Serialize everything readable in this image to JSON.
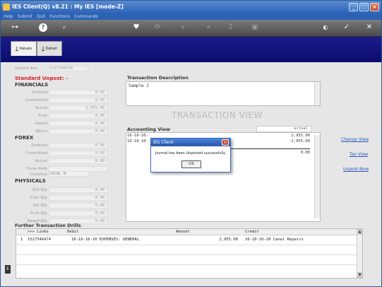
{
  "window": {
    "title": "IES Client(Q) v8.21 : My IES          [mode-Z]"
  },
  "menu": [
    "Help",
    "Submit",
    "Quit",
    "Functions",
    "Commands"
  ],
  "toolbar": {
    "help": "?",
    "search": "🔍"
  },
  "tabs": [
    {
      "num": "1",
      "label": "Values"
    },
    {
      "num": "2",
      "label": "Detail"
    }
  ],
  "system_key": {
    "label": "System Key",
    "value": "1527546474"
  },
  "standard_unpost": "Standard Unpost: -",
  "financials": {
    "title": "FINANCIALS",
    "rows": [
      {
        "label": "Ordered",
        "value": "0.00"
      },
      {
        "label": "Committed",
        "value": "0.00"
      },
      {
        "label": "Actual",
        "value": "2,955.00"
      },
      {
        "label": "Trust",
        "value": "0.00"
      },
      {
        "label": "Award",
        "value": "0.00"
      },
      {
        "label": "Memo",
        "value": "0.00"
      }
    ]
  },
  "forex": {
    "title": "FOREX",
    "rows": [
      {
        "label": "Ordered",
        "value": "0.00"
      },
      {
        "label": "Committed",
        "value": "0.00"
      },
      {
        "label": "Actual",
        "value": "0.00"
      },
      {
        "label": "Forex Rate",
        "value": ""
      },
      {
        "label": "Currency",
        "value": "LOCAL N"
      }
    ]
  },
  "physicals": {
    "title": "PHYSICALS",
    "rows": [
      {
        "label": "Ord Qty",
        "value": "0.00"
      },
      {
        "label": "Com Qty",
        "value": "0.00"
      },
      {
        "label": "Act Qty",
        "value": "0.00"
      },
      {
        "label": "Trust Qty",
        "value": "0.00"
      },
      {
        "label": "Award Qty",
        "value": "0.00"
      }
    ]
  },
  "transaction": {
    "desc_label": "Transaction Description",
    "desc_value": "Sample J",
    "view_title": "TRANSACTION VIEW",
    "accounting_view": "Accounting View",
    "actual_col": "actual",
    "rows": [
      {
        "acct": "10-10-10-",
        "amount": "2,955.00"
      },
      {
        "acct": "10-10-10-",
        "amount": "-2,955.00"
      }
    ],
    "total": "0.00"
  },
  "links": {
    "change_view": "Change View",
    "tax_view": "Tax View",
    "unpost_now": "Unpost Now"
  },
  "dialog": {
    "title": "IES Client",
    "message": "Journal has been Unposted successfully.",
    "ok": "OK"
  },
  "drills": {
    "title": "Further Transaction Drills",
    "headers": [
      ">>> Links",
      "Debit",
      "Amount",
      "Credit"
    ],
    "rows": [
      {
        "idx": "1",
        "link": "1527546474",
        "debit": "10-10-10-10 EXPENSES: GENERAL",
        "amount": "2,955.00",
        "credit": "10-10-10-20 Canal Repairs"
      }
    ]
  },
  "colors": {
    "title_blue": "#2c62b5",
    "header_navy": "#141480",
    "link_blue": "#2855b8",
    "unpost_red": "#d42020"
  }
}
